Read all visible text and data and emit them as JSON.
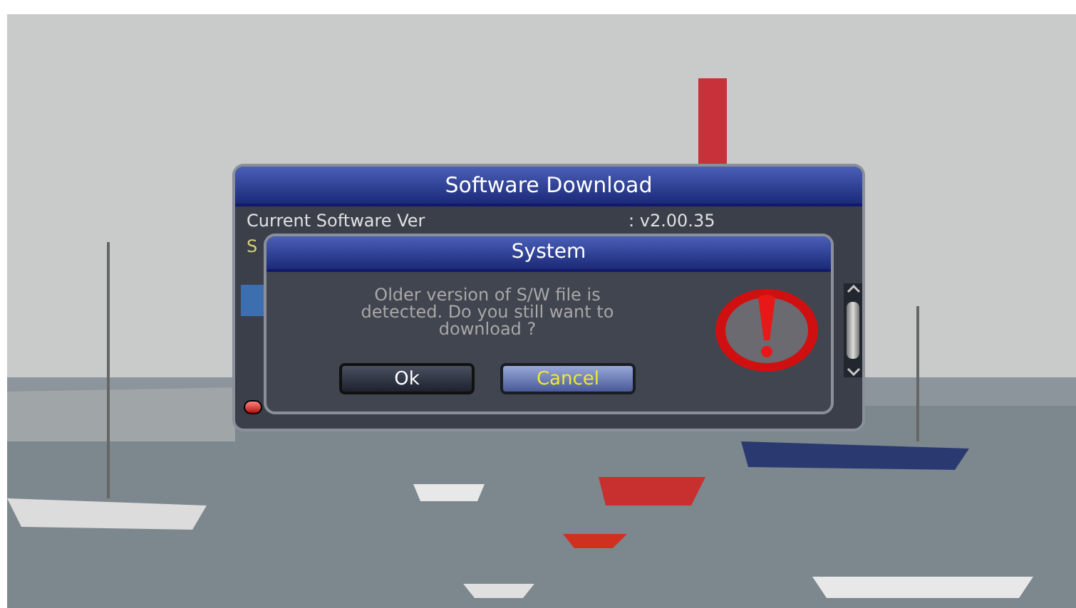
{
  "panel": {
    "title": "Software Download",
    "rows": [
      {
        "label": "Current Software Ver",
        "value": ": v2.00.35"
      },
      {
        "label": "S"
      }
    ]
  },
  "dialog": {
    "title": "System",
    "message": "Older version of S/W file is detected. Do you still want to download ?",
    "buttons": [
      {
        "label": "Ok",
        "selected": false
      },
      {
        "label": "Cancel",
        "selected": true
      }
    ]
  }
}
